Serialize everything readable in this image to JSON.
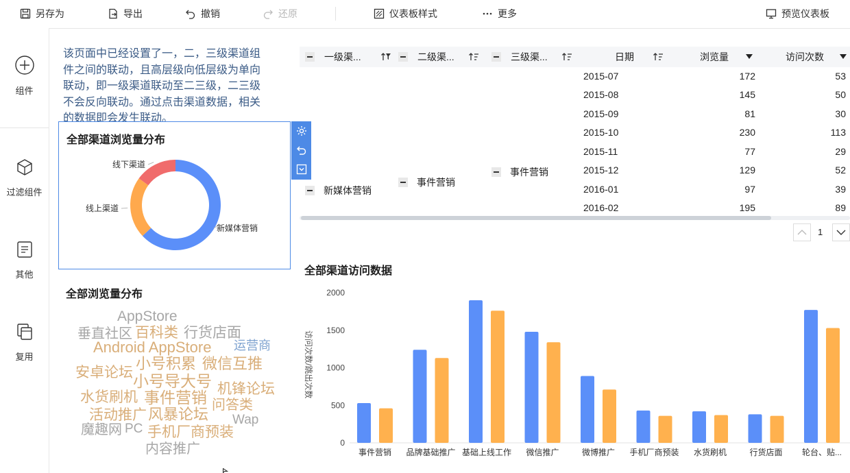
{
  "toolbar": {
    "save_as": "另存为",
    "export": "导出",
    "undo": "撤销",
    "redo": "还原",
    "dashboard_style": "仪表板样式",
    "more": "更多",
    "preview": "预览仪表板"
  },
  "rail": {
    "component": "组件",
    "filter": "过滤组件",
    "other": "其他",
    "reuse": "复用"
  },
  "description": "该页面中已经设置了一，二，三级渠道组件之间的联动，且高层级向低层级为单向联动，即一级渠道联动至二三级，二三级不会反向联动。通过点击渠道数据，相关的数据即会发生联动。",
  "donut": {
    "title": "全部渠道浏览量分布",
    "colors": [
      "#5b8ff9",
      "#ffa94d",
      "#f06b6b"
    ],
    "chart_data": {
      "type": "pie",
      "labels": [
        "新媒体营销",
        "线上渠道",
        "线下渠道"
      ],
      "values": [
        63,
        22,
        15
      ]
    }
  },
  "wordcloud": {
    "title": "全部浏览量分布",
    "words": [
      "AppStore",
      "垂直社区",
      "百科类",
      "行货店面",
      "Android AppStore",
      "运营商",
      "小号积累",
      "微信互推",
      "安卓论坛",
      "小号导大号",
      "机锋论坛",
      "水货刷机",
      "事件营销",
      "问答类",
      "活动推广",
      "风暴论坛",
      "Wap",
      "魔趣网",
      "PC",
      "手机厂商预装",
      "内容推广"
    ]
  },
  "table": {
    "headers": [
      "一级渠...",
      "二级渠...",
      "三级渠...",
      "日期",
      "浏览量",
      "访问次数"
    ],
    "level1": "新媒体营销",
    "level2": "事件营销",
    "level3": "事件营销",
    "rows": [
      [
        "2015-07",
        "172",
        "53"
      ],
      [
        "2015-08",
        "145",
        "50"
      ],
      [
        "2015-09",
        "81",
        "30"
      ],
      [
        "2015-10",
        "230",
        "113"
      ],
      [
        "2015-11",
        "77",
        "29"
      ],
      [
        "2015-12",
        "129",
        "52"
      ],
      [
        "2016-01",
        "97",
        "39"
      ],
      [
        "2016-02",
        "195",
        "89"
      ]
    ],
    "page": "1"
  },
  "bar": {
    "title": "全部渠道访问数据",
    "ylabel": "访问次数/跳出次数",
    "colors": [
      "#5b8ff9",
      "#ffb14e"
    ],
    "chart_data": {
      "type": "bar",
      "categories": [
        "事件营销",
        "品牌基础推广",
        "基础上线工作",
        "微信推广",
        "微博推广",
        "手机厂商预装",
        "水货刷机",
        "行货店面",
        "轮台、贴..."
      ],
      "series": [
        {
          "values": [
            530,
            1240,
            1900,
            1480,
            890,
            430,
            420,
            380,
            1770
          ]
        },
        {
          "values": [
            460,
            1130,
            1760,
            1340,
            710,
            360,
            370,
            360,
            1530
          ]
        }
      ],
      "yticks": [
        "0",
        "500",
        "1000",
        "1500",
        "2000"
      ],
      "ylim": [
        0,
        2000
      ]
    }
  }
}
